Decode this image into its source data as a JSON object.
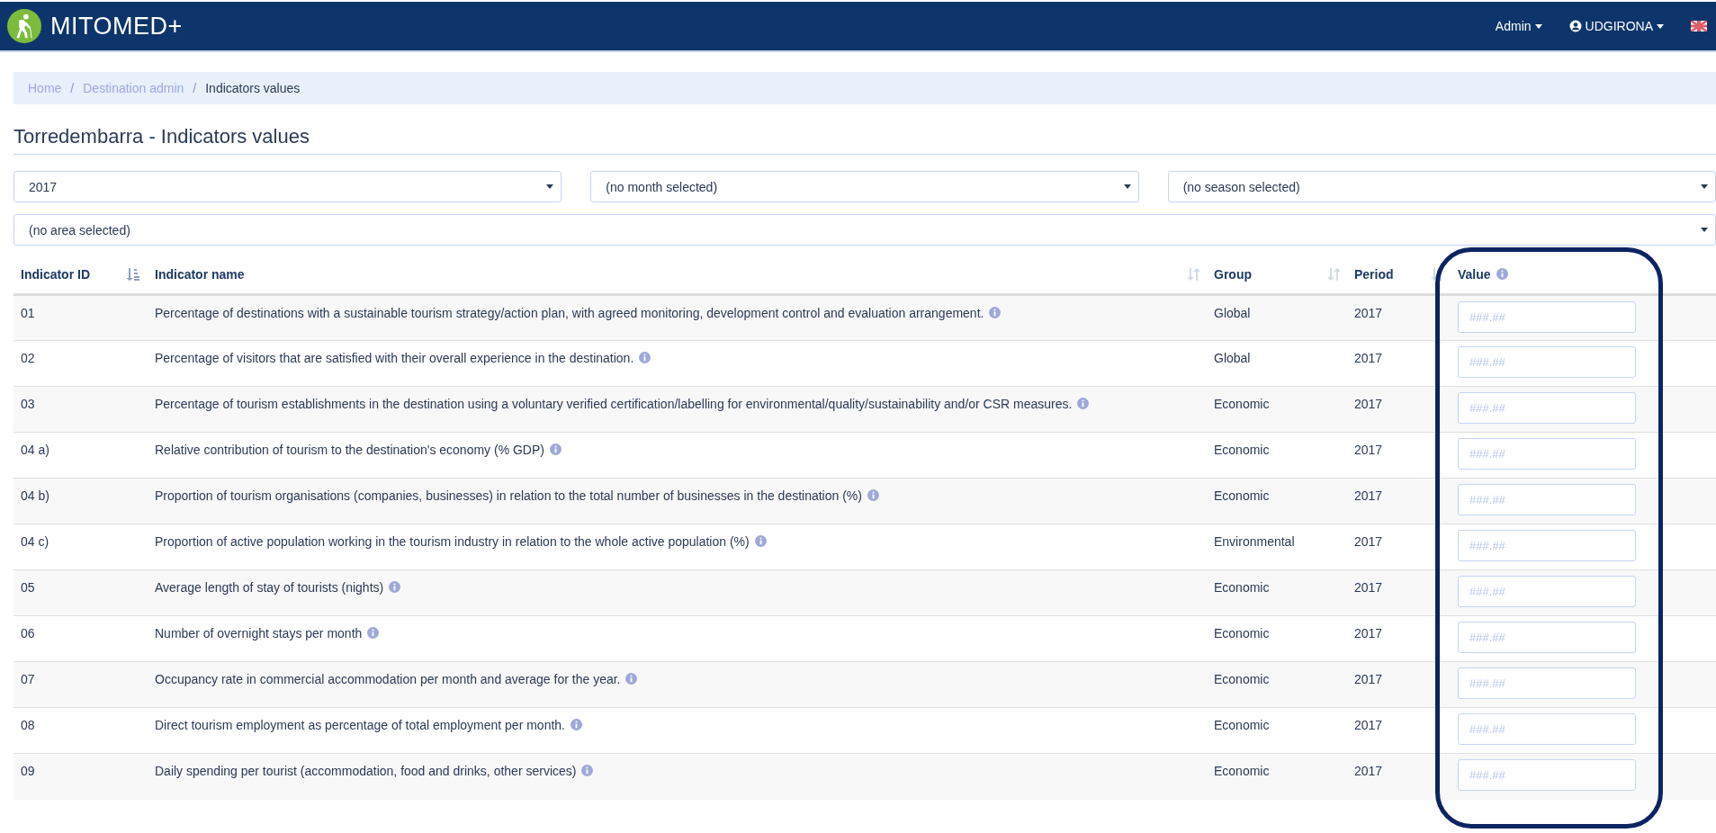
{
  "navbar": {
    "brand": "MITOMED+",
    "menus": [
      {
        "label": "Admin",
        "kind": "plain"
      },
      {
        "label": "UDGIRONA",
        "kind": "user"
      }
    ]
  },
  "breadcrumb": [
    {
      "label": "Home",
      "selected": false
    },
    {
      "separator": "/",
      "label": "Destination admin",
      "selected": false
    },
    {
      "separator": "/",
      "label": "Indicators values",
      "selected": true
    }
  ],
  "title": "Torredembarra - Indicators values",
  "filters": [
    {
      "value": "2017"
    },
    {
      "value": "(no month selected)"
    },
    {
      "value": "(no season selected)"
    }
  ],
  "area_filter": {
    "value": "(no area selected)"
  },
  "table": {
    "columns": [
      {
        "label": "Indicator ID",
        "sortable": true,
        "sorted": true,
        "info": false
      },
      {
        "label": "Indicator name",
        "sortable": true,
        "sorted": false,
        "info": false
      },
      {
        "label": "Group",
        "sortable": true,
        "sorted": false,
        "info": false
      },
      {
        "label": "Period",
        "sortable": true,
        "sorted": false,
        "info": false
      },
      {
        "label": "Value",
        "sortable": false,
        "info": true
      }
    ],
    "rows": [
      {
        "id": "01",
        "name": "Percentage of destinations with a sustainable tourism strategy/action plan, with agreed monitoring, development control and evaluation arrangement.",
        "group": "Global",
        "period": "2017",
        "placeholder": "###.##"
      },
      {
        "id": "02",
        "name": "Percentage of visitors that are satisfied with their overall experience in the destination.",
        "group": "Global",
        "period": "2017",
        "placeholder": "###.##"
      },
      {
        "id": "03",
        "name": "Percentage of tourism establishments in the destination using a voluntary verified certification/labelling for environmental/quality/sustainability and/or CSR measures.",
        "group": "Economic",
        "period": "2017",
        "placeholder": "###.##"
      },
      {
        "id": "04 a)",
        "name": "Relative contribution of tourism to the destination's economy (% GDP)",
        "group": "Economic",
        "period": "2017",
        "placeholder": "###.##"
      },
      {
        "id": "04 b)",
        "name": "Proportion of tourism organisations (companies, businesses) in relation to the total number of businesses in the destination (%)",
        "group": "Economic",
        "period": "2017",
        "placeholder": "###.##"
      },
      {
        "id": "04 c)",
        "name": "Proportion of active population working in the tourism industry in relation to the whole active population (%)",
        "group": "Environmental",
        "period": "2017",
        "placeholder": "###.##"
      },
      {
        "id": "05",
        "name": "Average length of stay of tourists (nights)",
        "group": "Economic",
        "period": "2017",
        "placeholder": "###.##"
      },
      {
        "id": "06",
        "name": "Number of overnight stays per month",
        "group": "Economic",
        "period": "2017",
        "placeholder": "###.##"
      },
      {
        "id": "07",
        "name": "Occupancy rate in commercial accommodation per month and average for the year.",
        "group": "Economic",
        "period": "2017",
        "placeholder": "###.##"
      },
      {
        "id": "08",
        "name": "Direct tourism employment as percentage of total employment per month.",
        "group": "Economic",
        "period": "2017",
        "placeholder": "###.##"
      },
      {
        "id": "09",
        "name": "Daily spending per tourist (accommodation, food and drinks, other services)",
        "group": "Economic",
        "period": "2017",
        "placeholder": "###.##"
      }
    ]
  }
}
